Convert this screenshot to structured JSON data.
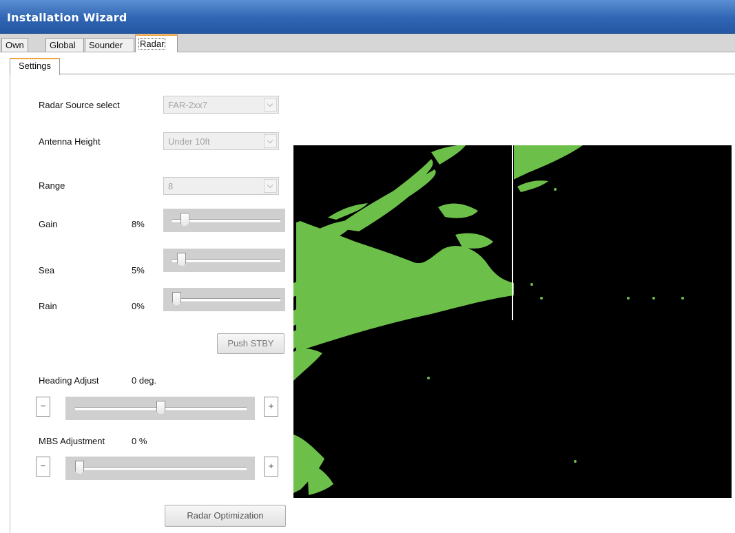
{
  "window": {
    "title": "Installation Wizard"
  },
  "tabs": [
    {
      "label": "Own"
    },
    {
      "label": "Global"
    },
    {
      "label": "Sounder"
    },
    {
      "label": "Radar",
      "active": true
    }
  ],
  "subtabs": [
    {
      "label": "Settings",
      "active": true
    }
  ],
  "settings": {
    "radar_source": {
      "label": "Radar Source select",
      "value": "FAR-2xx7"
    },
    "antenna_height": {
      "label": "Antenna Height",
      "value": "Under 10ft"
    },
    "range": {
      "label": "Range",
      "value": "8"
    },
    "gain": {
      "label": "Gain",
      "value_text": "8%",
      "value": 8
    },
    "sea": {
      "label": "Sea",
      "value_text": "5%",
      "value": 5
    },
    "rain": {
      "label": "Rain",
      "value_text": "0%",
      "value": 0
    },
    "push_stby_label": "Push STBY",
    "heading_adjust": {
      "label": "Heading Adjust",
      "value_text": "0 deg.",
      "value": 0
    },
    "mbs_adjustment": {
      "label": "MBS Adjustment",
      "value_text": "0 %",
      "value": 0
    },
    "minus_label": "−",
    "plus_label": "+",
    "radar_optimization_label": "Radar Optimization"
  },
  "colors": {
    "titlebar": "#2f65b3",
    "echo": "#6cc04a",
    "radar_background": "#000000",
    "tab_highlight": "#f2a33a"
  },
  "icons": {
    "combo_arrow": "chevron-down-icon"
  }
}
